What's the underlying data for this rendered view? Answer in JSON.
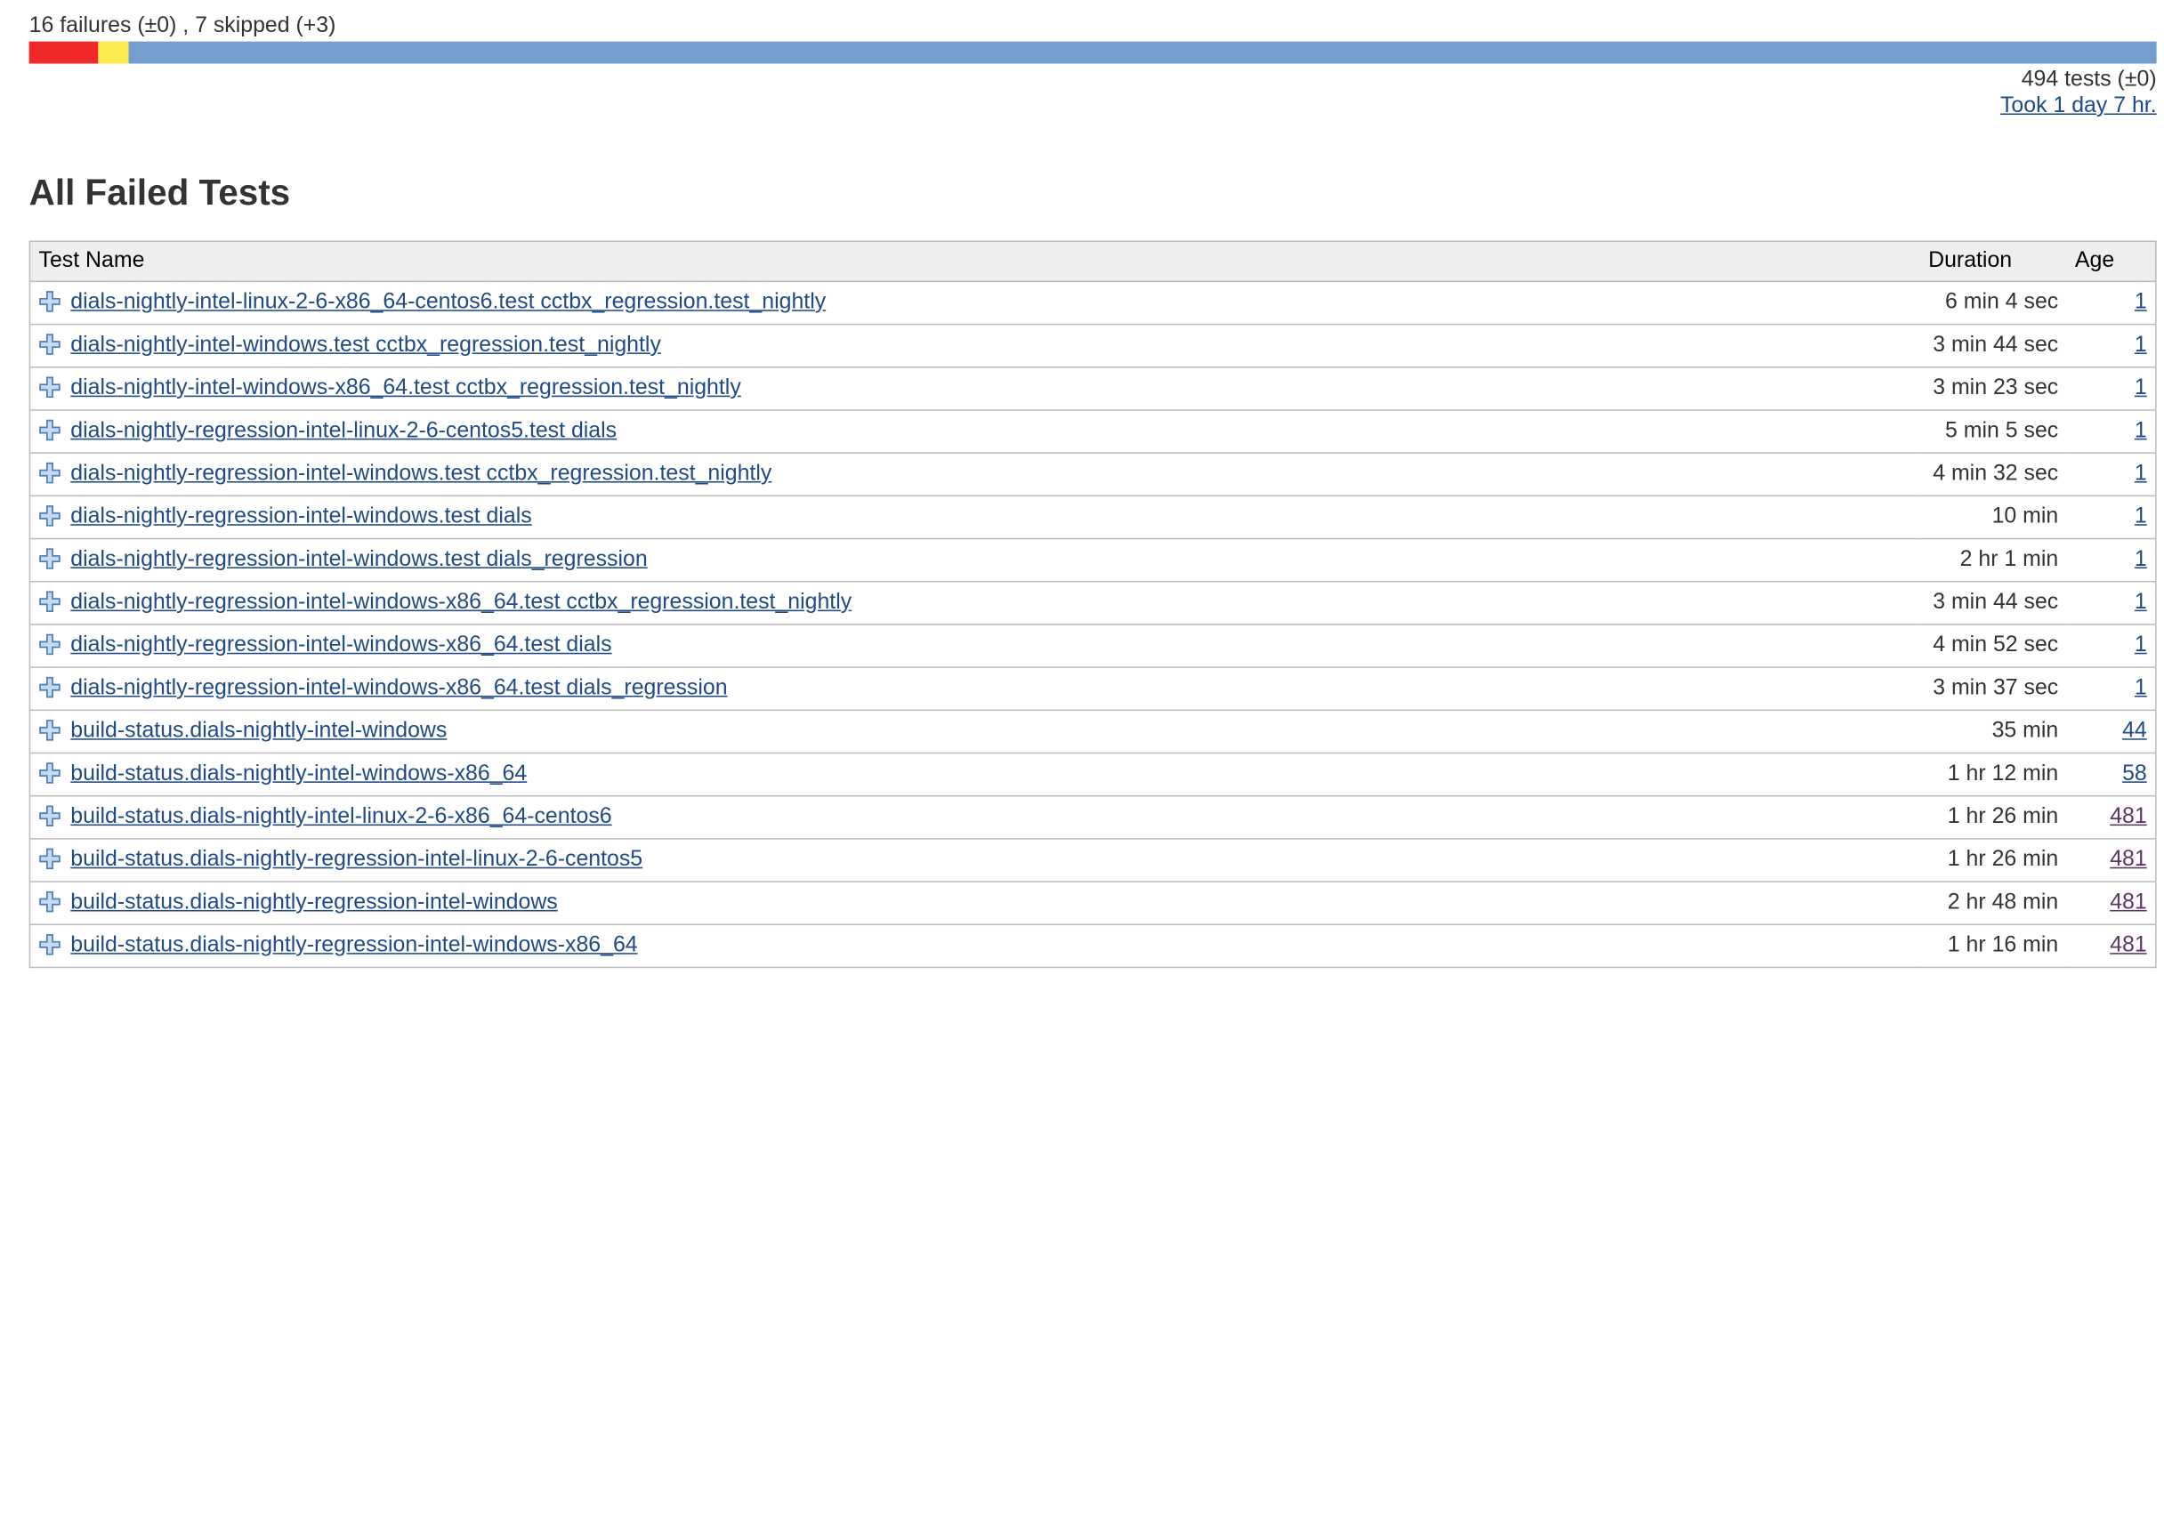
{
  "summary": {
    "text": "16 failures (±0) , 7 skipped (+3)",
    "fail_fraction": 0.0324,
    "skip_fraction": 0.0142,
    "total_tests": "494 tests (±0)",
    "took": "Took 1 day 7 hr.",
    "colors": {
      "fail": "#ef2929",
      "skip": "#fce94f",
      "pass": "#729fcf"
    }
  },
  "section_title": "All Failed Tests",
  "table": {
    "headers": {
      "name": "Test Name",
      "duration": "Duration",
      "age": "Age"
    },
    "rows": [
      {
        "name": "dials-nightly-intel-linux-2-6-x86_64-centos6.test cctbx_regression.test_nightly",
        "duration": "6 min 4 sec",
        "age": "1",
        "visited": false
      },
      {
        "name": "dials-nightly-intel-windows.test cctbx_regression.test_nightly",
        "duration": "3 min 44 sec",
        "age": "1",
        "visited": false
      },
      {
        "name": "dials-nightly-intel-windows-x86_64.test cctbx_regression.test_nightly",
        "duration": "3 min 23 sec",
        "age": "1",
        "visited": false
      },
      {
        "name": "dials-nightly-regression-intel-linux-2-6-centos5.test dials",
        "duration": "5 min 5 sec",
        "age": "1",
        "visited": false
      },
      {
        "name": "dials-nightly-regression-intel-windows.test cctbx_regression.test_nightly",
        "duration": "4 min 32 sec",
        "age": "1",
        "visited": false
      },
      {
        "name": "dials-nightly-regression-intel-windows.test dials",
        "duration": "10 min",
        "age": "1",
        "visited": false
      },
      {
        "name": "dials-nightly-regression-intel-windows.test dials_regression",
        "duration": "2 hr 1 min",
        "age": "1",
        "visited": false
      },
      {
        "name": "dials-nightly-regression-intel-windows-x86_64.test cctbx_regression.test_nightly",
        "duration": "3 min 44 sec",
        "age": "1",
        "visited": false
      },
      {
        "name": "dials-nightly-regression-intel-windows-x86_64.test dials",
        "duration": "4 min 52 sec",
        "age": "1",
        "visited": false
      },
      {
        "name": "dials-nightly-regression-intel-windows-x86_64.test dials_regression",
        "duration": "3 min 37 sec",
        "age": "1",
        "visited": false
      },
      {
        "name": "build-status.dials-nightly-intel-windows",
        "duration": "35 min",
        "age": "44",
        "visited": false
      },
      {
        "name": "build-status.dials-nightly-intel-windows-x86_64",
        "duration": "1 hr 12 min",
        "age": "58",
        "visited": false
      },
      {
        "name": "build-status.dials-nightly-intel-linux-2-6-x86_64-centos6",
        "duration": "1 hr 26 min",
        "age": "481",
        "visited": true
      },
      {
        "name": "build-status.dials-nightly-regression-intel-linux-2-6-centos5",
        "duration": "1 hr 26 min",
        "age": "481",
        "visited": true
      },
      {
        "name": "build-status.dials-nightly-regression-intel-windows",
        "duration": "2 hr 48 min",
        "age": "481",
        "visited": true
      },
      {
        "name": "build-status.dials-nightly-regression-intel-windows-x86_64",
        "duration": "1 hr 16 min",
        "age": "481",
        "visited": true
      }
    ]
  },
  "icons": {
    "expand": "plus-icon"
  }
}
